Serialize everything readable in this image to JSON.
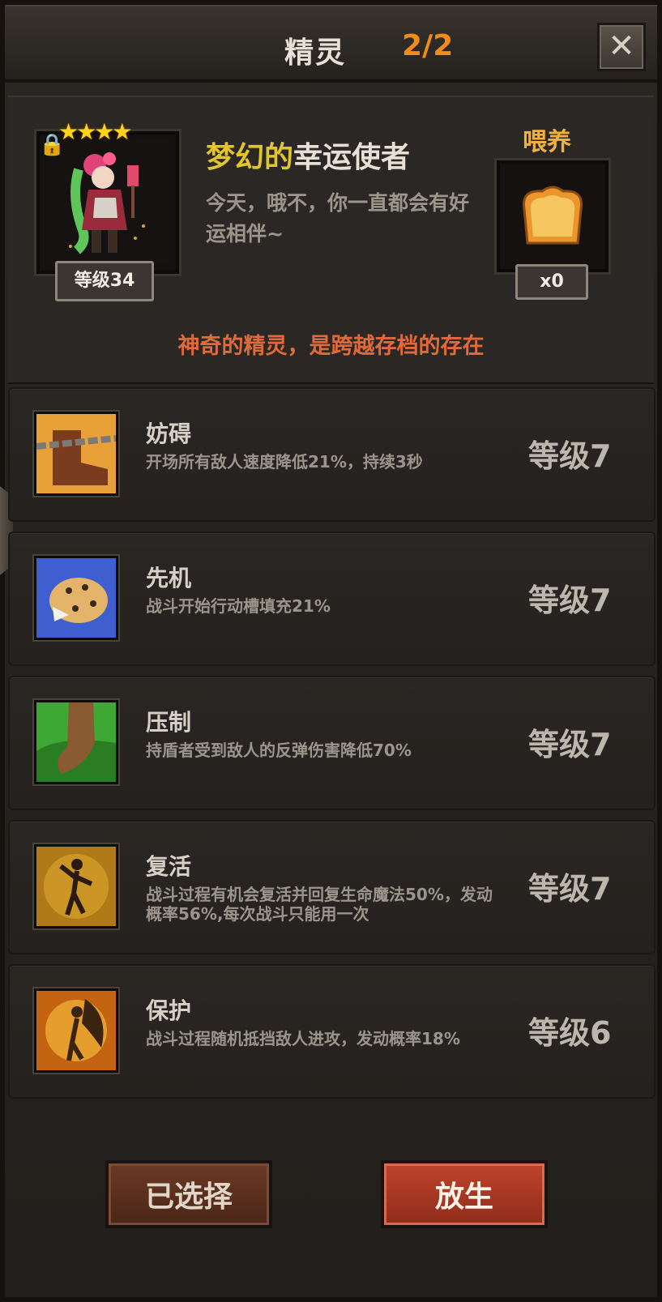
{
  "header": {
    "title": "精灵",
    "count": "2/2",
    "close_label": "✕"
  },
  "hero": {
    "stars": "★★★★",
    "level_badge": "等级34",
    "name_accent": "梦幻的",
    "name_rest": "幸运使者",
    "description": "今天，哦不，你一直都会有好运相伴~",
    "feed_label": "喂养",
    "food_count": "x0",
    "note": "神奇的精灵，是跨越存档的存在"
  },
  "skills": [
    {
      "name": "妨碍",
      "desc": "开场所有敌人速度降低21%，持续3秒",
      "level": "等级7",
      "icon": "chained-boot-icon"
    },
    {
      "name": "先机",
      "desc": "战斗开始行动槽填充21%",
      "level": "等级7",
      "icon": "leopard-icon"
    },
    {
      "name": "压制",
      "desc": "持盾者受到敌人的反弹伤害降低70%",
      "level": "等级7",
      "icon": "beast-claw-icon"
    },
    {
      "name": "复活",
      "desc": "战斗过程有机会复活并回复生命魔法50%，发动概率56%,每次战斗只能用一次",
      "level": "等级7",
      "icon": "dancing-figure-icon"
    },
    {
      "name": "保护",
      "desc": "战斗过程随机抵挡敌人进攻，发动概率18%",
      "level": "等级6",
      "icon": "fairy-icon"
    }
  ],
  "buttons": {
    "selected": "已选择",
    "release": "放生"
  }
}
